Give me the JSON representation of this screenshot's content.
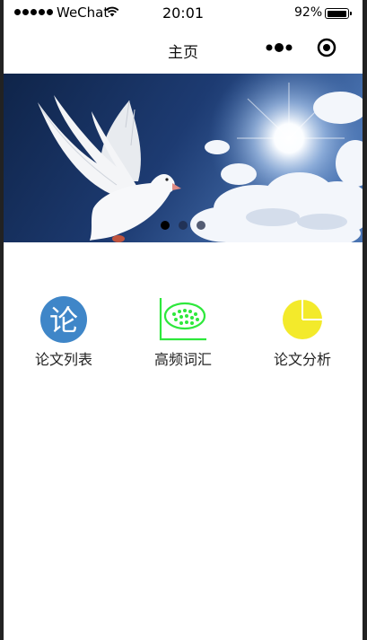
{
  "status_bar": {
    "carrier": "WeChat",
    "time": "20:01",
    "battery": "92%",
    "battery_level": 0.92,
    "icons": [
      "signal-icon",
      "wifi-icon",
      "battery-icon"
    ]
  },
  "nav": {
    "title": "主页",
    "icons": [
      "more-icon",
      "target-icon"
    ]
  },
  "swiper": {
    "slide_description_icon": "dove-sky-banner",
    "active_index": 0,
    "slide_count": 3
  },
  "features": [
    {
      "label": "论文列表",
      "icon": "paper-list-icon",
      "icon_char": "论",
      "color": "#3f86c8"
    },
    {
      "label": "高频词汇",
      "icon": "word-cloud-icon",
      "color": "#2ee83c"
    },
    {
      "label": "论文分析",
      "icon": "pie-chart-icon",
      "color": "#f3ea2b"
    }
  ]
}
